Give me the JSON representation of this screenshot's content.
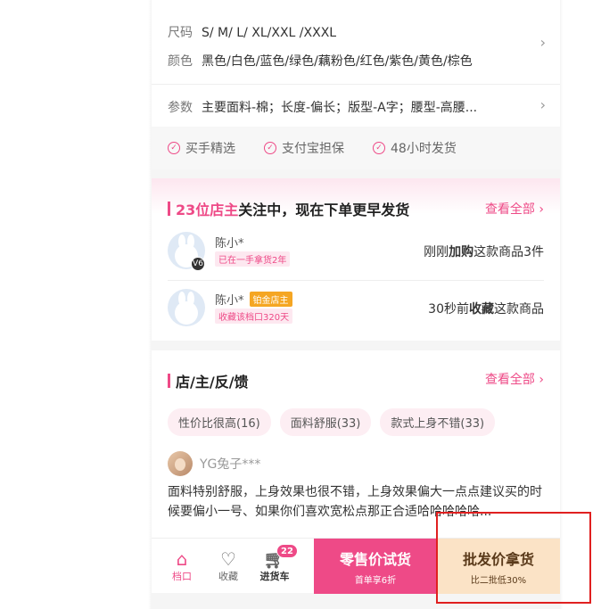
{
  "spec": {
    "size_key": "尺码",
    "size_val": "S/ M/ L/ XL/XXL /XXXL",
    "color_key": "颜色",
    "color_val": "黑色/白色/蓝色/绿色/藕粉色/红色/紫色/黄色/棕色",
    "param_key": "参数",
    "param_val": "主要面料-棉；长度-偏长；版型-A字；腰型-高腰...",
    "chevron": "›"
  },
  "promises": [
    "买手精选",
    "支付宝担保",
    "48小时发货"
  ],
  "follow": {
    "count_text": "23位店主",
    "title_rest": "关注中，现在下单更早发货",
    "see_all": "查看全部 ›",
    "users": [
      {
        "name": "陈小*",
        "tag": "已在一手拿货2年",
        "badge": "V6",
        "action_pre": "刚刚",
        "action_bold": "加购",
        "action_post": "这款商品3件"
      },
      {
        "name": "陈小*",
        "gold": "铂金店主",
        "tag": "收藏该档口320天",
        "action_pre": "30秒前",
        "action_bold": "收藏",
        "action_post": "这款商品"
      }
    ]
  },
  "feedback": {
    "title": "店/主/反/馈",
    "see_all": "查看全部 ›",
    "chips": [
      "性价比很高(16)",
      "面料舒服(33)",
      "款式上身不错(33)"
    ],
    "user": "YG兔子***",
    "text": "面料特别舒服，上身效果也很不错，上身效果偏大一点点建议买的时候要偏小一号、如果你们喜欢宽松点那正合适哈哈哈哈哈..."
  },
  "bottom": {
    "nav": [
      {
        "label": "档口",
        "icon": "shop-icon"
      },
      {
        "label": "收藏",
        "icon": "heart-icon"
      },
      {
        "label": "进货车",
        "icon": "cart-icon"
      }
    ],
    "cart_count": "22",
    "retail_main": "零售价试货",
    "retail_sub": "首单享6折",
    "wholesale_main": "批发价拿货",
    "wholesale_sub": "比二批低30%"
  },
  "colors": {
    "accent": "#ee4a87",
    "wholesale_bg": "#fbe3c6",
    "highlight": "#e02020"
  }
}
